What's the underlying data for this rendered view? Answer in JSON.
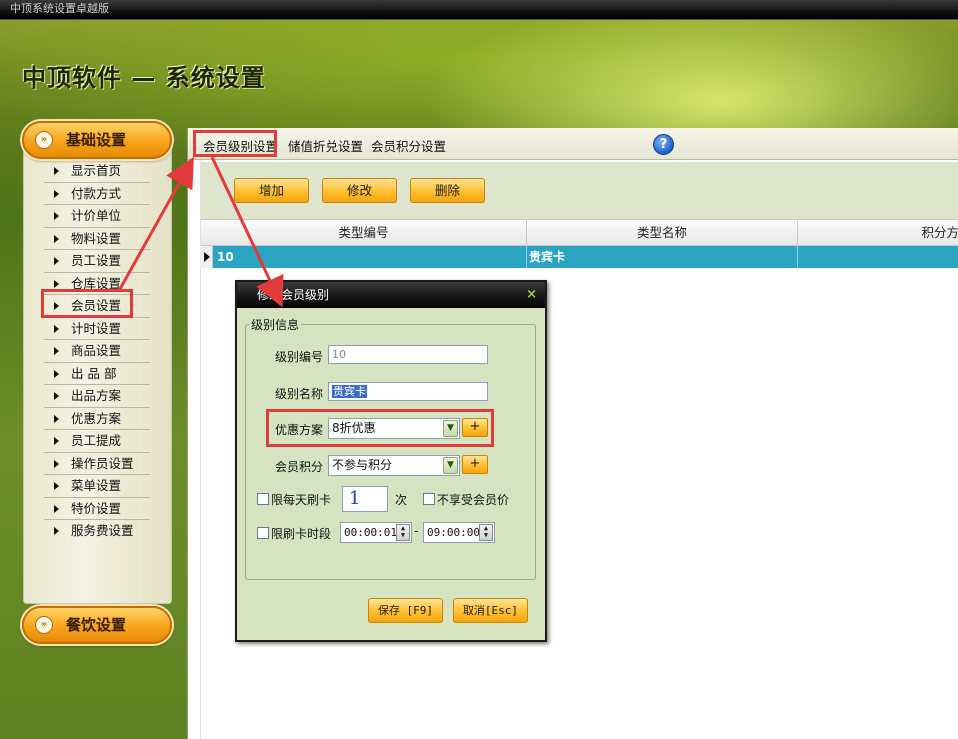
{
  "window": {
    "title": "中顶系统设置卓越版"
  },
  "header": {
    "app_title": "中顶软件 — 系统设置"
  },
  "sidebar": {
    "section_basic": "基础设置",
    "section_dining": "餐饮设置",
    "items": [
      {
        "label": "显示首页"
      },
      {
        "label": "付款方式"
      },
      {
        "label": "计价单位"
      },
      {
        "label": "物料设置"
      },
      {
        "label": "员工设置"
      },
      {
        "label": "仓库设置"
      },
      {
        "label": "会员设置"
      },
      {
        "label": "计时设置"
      },
      {
        "label": "商品设置"
      },
      {
        "label": "出 品 部"
      },
      {
        "label": "出品方案"
      },
      {
        "label": "优惠方案"
      },
      {
        "label": "员工提成"
      },
      {
        "label": "操作员设置"
      },
      {
        "label": "菜单设置"
      },
      {
        "label": "特价设置"
      },
      {
        "label": "服务费设置"
      }
    ]
  },
  "tabs": [
    {
      "label": "会员级别设置"
    },
    {
      "label": "储值折兑设置"
    },
    {
      "label": "会员积分设置"
    }
  ],
  "help_icon": "?",
  "toolbar": {
    "add": "增加",
    "edit": "修改",
    "delete": "删除"
  },
  "grid": {
    "columns": [
      "类型编号",
      "类型名称",
      "积分方"
    ],
    "rows": [
      {
        "code": "10",
        "name": "贵宾卡",
        "points": ""
      }
    ]
  },
  "dialog": {
    "title": "修改会员级别",
    "close": "×",
    "group_title": "级别信息",
    "level_code_label": "级别编号",
    "level_code_value": "10",
    "level_name_label": "级别名称",
    "level_name_value": "贵宾卡",
    "discount_label": "优惠方案",
    "discount_value": "8折优惠",
    "points_label": "会员积分",
    "points_value": "不参与积分",
    "plus": "+",
    "daily_limit_label": "限每天刷卡",
    "daily_limit_value": "1",
    "times_unit": "次",
    "no_member_price_label": "不享受会员价",
    "time_limit_label": "限刷卡时段",
    "time_start": "00:00:01",
    "time_sep": "-",
    "time_end": "09:00:00",
    "save": "保存 [F9]",
    "cancel": "取消[Esc]"
  },
  "colors": {
    "highlight": "#e23b3b",
    "accent_orange": "#f8a41a",
    "selected_row": "#2aa4c1"
  }
}
